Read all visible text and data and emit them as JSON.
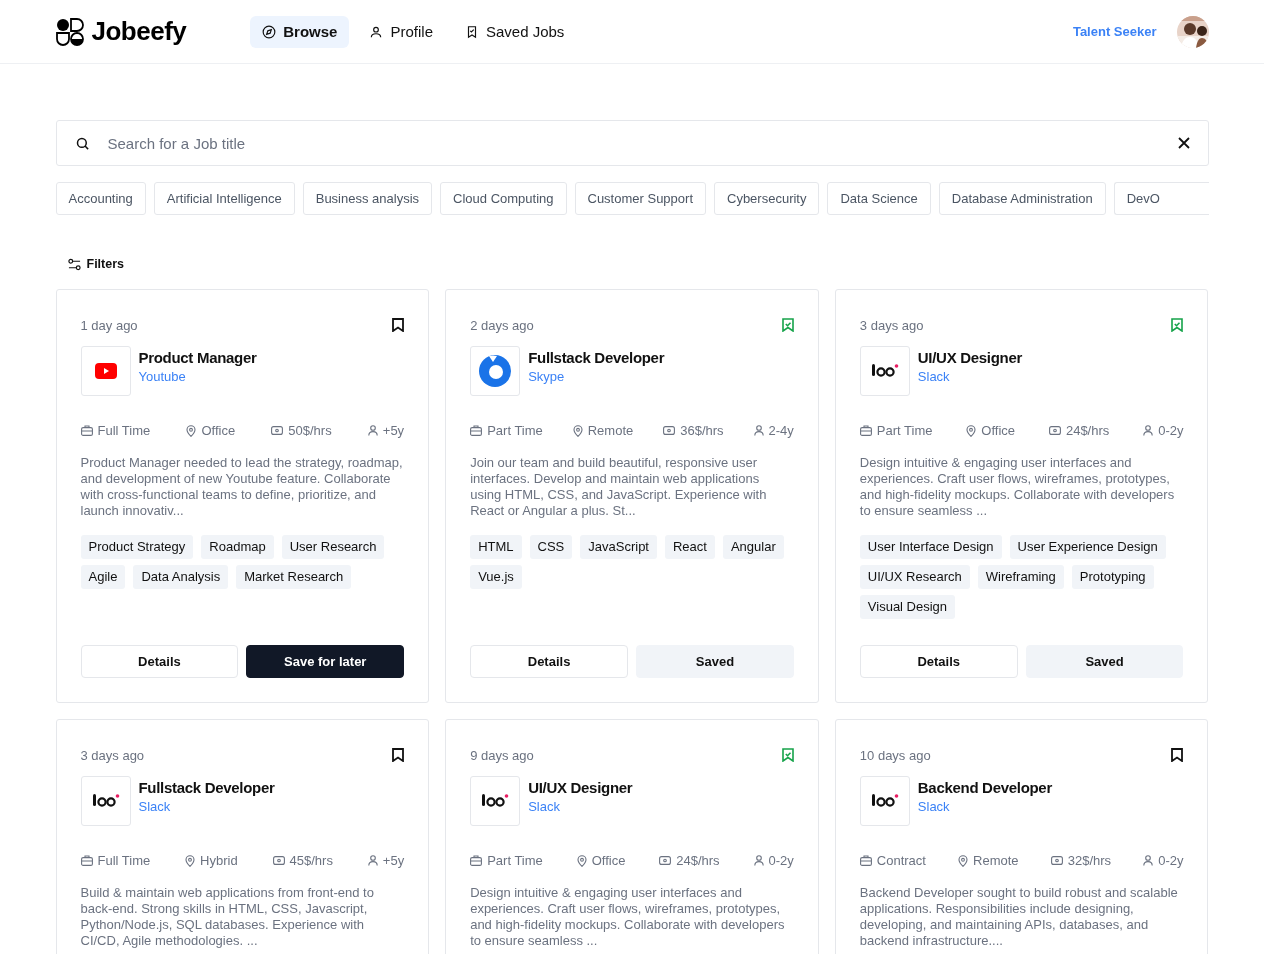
{
  "header": {
    "brand": "Jobeefy",
    "nav": [
      {
        "label": "Browse",
        "selected": true
      },
      {
        "label": "Profile",
        "selected": false
      },
      {
        "label": "Saved Jobs",
        "selected": false
      }
    ],
    "user_role": "Talent Seeker"
  },
  "search": {
    "placeholder": "Search for a Job title"
  },
  "categories": [
    "Accounting",
    "Artificial Intelligence",
    "Business analysis",
    "Cloud Computing",
    "Customer Support",
    "Cybersecurity",
    "Data Science",
    "Database Administration",
    "DevO"
  ],
  "filters_label": "Filters",
  "jobs": [
    {
      "posted": "1 day ago",
      "saved": false,
      "title": "Product Manager",
      "company": "Youtube",
      "logo": {
        "kind": "youtube"
      },
      "type": "Full Time",
      "location": "Office",
      "rate": "50$/hrs",
      "experience": "+5y",
      "description": "Product Manager needed to lead the strategy, roadmap, and development of new Youtube feature. Collaborate with cross-functional teams to define, prioritize, and launch innovativ...",
      "tags": [
        "Product Strategy",
        "Roadmap",
        "User Research",
        "Agile",
        "Data Analysis",
        "Market Research"
      ],
      "details_label": "Details",
      "save_label": "Save for later"
    },
    {
      "posted": "2 days ago",
      "saved": true,
      "title": "Fullstack Developer",
      "company": "Skype",
      "logo": {
        "kind": "skype"
      },
      "type": "Part Time",
      "location": "Remote",
      "rate": "36$/hrs",
      "experience": "2-4y",
      "description": "Join our team and build beautiful, responsive user interfaces. Develop and maintain web applications using HTML, CSS, and JavaScript. Experience with React or Angular a plus. St...",
      "tags": [
        "HTML",
        "CSS",
        "JavaScript",
        "React",
        "Angular",
        "Vue.js"
      ],
      "details_label": "Details",
      "save_label": "Saved"
    },
    {
      "posted": "3 days ago",
      "saved": true,
      "title": "UI/UX Designer",
      "company": "Slack",
      "logo": {
        "kind": "placeholder"
      },
      "type": "Part Time",
      "location": "Office",
      "rate": "24$/hrs",
      "experience": "0-2y",
      "description": "Design intuitive & engaging user interfaces and experiences. Craft user flows, wireframes, prototypes, and high-fidelity mockups. Collaborate with developers to ensure seamless ...",
      "tags": [
        "User Interface Design",
        "User Experience Design",
        "UI/UX Research",
        "Wireframing",
        "Prototyping",
        "Visual Design"
      ],
      "details_label": "Details",
      "save_label": "Saved"
    },
    {
      "posted": "3 days ago",
      "saved": false,
      "title": "Fullstack Developer",
      "company": "Slack",
      "logo": {
        "kind": "placeholder"
      },
      "type": "Full Time",
      "location": "Hybrid",
      "rate": "45$/hrs",
      "experience": "+5y",
      "description": "Build & maintain web applications from front-end to back-end. Strong skills in HTML, CSS, Javascript, Python/Node.js, SQL databases. Experience with CI/CD, Agile methodologies. ..."
    },
    {
      "posted": "9 days ago",
      "saved": true,
      "title": "UI/UX Designer",
      "company": "Slack",
      "logo": {
        "kind": "placeholder"
      },
      "type": "Part Time",
      "location": "Office",
      "rate": "24$/hrs",
      "experience": "0-2y",
      "description": "Design intuitive & engaging user interfaces and experiences. Craft user flows, wireframes, prototypes, and high-fidelity mockups. Collaborate with developers to ensure seamless ..."
    },
    {
      "posted": "10 days ago",
      "saved": false,
      "title": "Backend Developer",
      "company": "Slack",
      "logo": {
        "kind": "placeholder"
      },
      "type": "Contract",
      "location": "Remote",
      "rate": "32$/hrs",
      "experience": "0-2y",
      "description": "Backend Developer sought to build robust and scalable applications. Responsibilities include designing, developing, and maintaining APIs, databases, and backend infrastructure...."
    }
  ]
}
